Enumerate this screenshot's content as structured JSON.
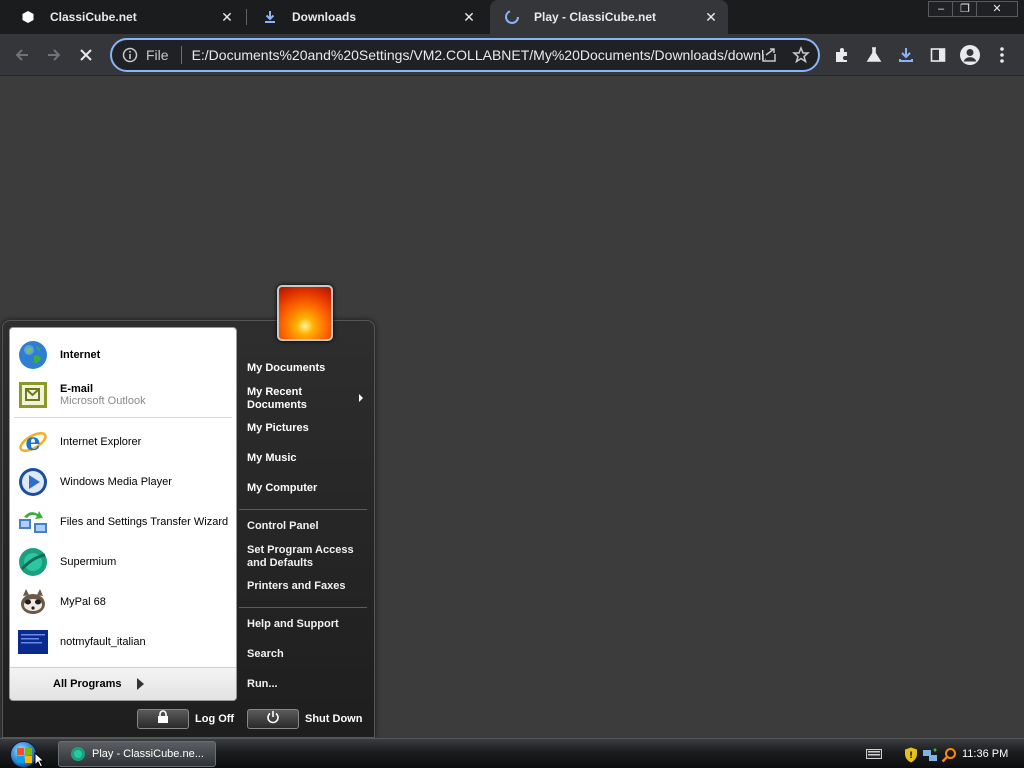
{
  "browser": {
    "tabs": [
      {
        "title": "ClassiCube.net",
        "icon": "hexagon-icon",
        "active": false
      },
      {
        "title": "Downloads",
        "icon": "download-icon",
        "active": false
      },
      {
        "title": "Play - ClassiCube.net",
        "icon": "loading-icon",
        "active": true
      }
    ],
    "window_controls": {
      "minimize": "–",
      "restore": "❐",
      "close": "✕"
    },
    "omnibox": {
      "scheme_label": "File",
      "url": "E:/Documents%20and%20Settings/VM2.COLLABNET/My%20Documents/Downloads/downl..."
    },
    "colors": {
      "omnibox_focus": "#8ab4f8",
      "download_accent": "#8ab4f8"
    }
  },
  "start_menu": {
    "pinned": [
      {
        "name": "Internet",
        "sub": "",
        "bold": true,
        "icon": "globe-icon"
      },
      {
        "name": "E-mail",
        "sub": "Microsoft Outlook",
        "bold": true,
        "icon": "email-icon"
      }
    ],
    "recent": [
      {
        "name": "Internet Explorer",
        "icon": "internet-explorer-icon"
      },
      {
        "name": "Windows Media Player",
        "icon": "media-player-icon"
      },
      {
        "name": "Files and Settings Transfer Wizard",
        "icon": "transfer-wizard-icon"
      },
      {
        "name": "Supermium",
        "icon": "supermium-icon"
      },
      {
        "name": "MyPal 68",
        "icon": "mypal-icon"
      },
      {
        "name": "notmyfault_italian",
        "icon": "notmyfault-icon"
      }
    ],
    "all_programs": "All Programs",
    "places": [
      {
        "label": "My Documents"
      },
      {
        "label": "My Recent Documents"
      },
      {
        "label": "My Pictures"
      },
      {
        "label": "My Music"
      },
      {
        "label": "My Computer"
      }
    ],
    "settings": [
      {
        "label": "Control Panel"
      },
      {
        "label": "Set Program Access and Defaults"
      },
      {
        "label": "Printers and Faxes"
      }
    ],
    "help": [
      {
        "label": "Help and Support"
      },
      {
        "label": "Search"
      },
      {
        "label": "Run..."
      }
    ],
    "log_off": "Log Off",
    "shut_down": "Shut Down"
  },
  "taskbar": {
    "task_label": "Play - ClassiCube.ne...",
    "clock": "11:36 PM"
  }
}
